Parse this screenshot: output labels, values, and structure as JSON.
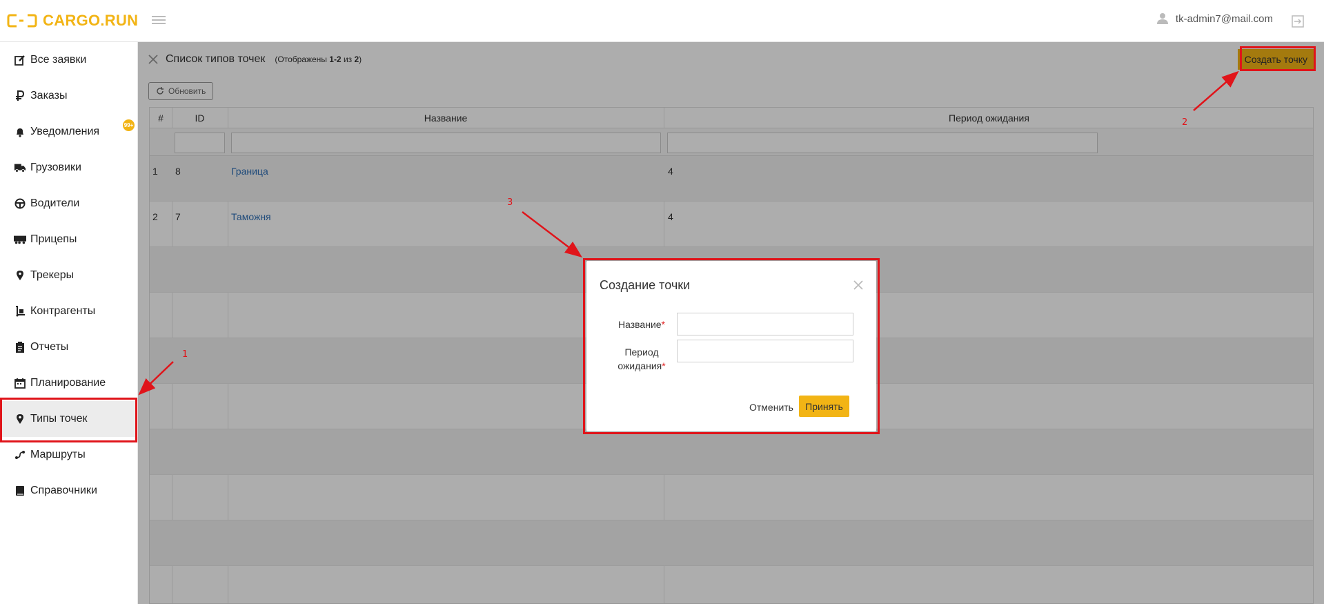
{
  "brand": {
    "name": "CARGO.RUN",
    "color": "#f2b415"
  },
  "header": {
    "user_email": "tk-admin7@mail.com",
    "menu_icon": "hamburger-icon",
    "user_icon": "user-icon",
    "logout_icon": "logout-icon"
  },
  "sidebar": {
    "items": [
      {
        "label": "Все заявки",
        "icon": "edit-icon"
      },
      {
        "label": "Заказы",
        "icon": "ruble-icon"
      },
      {
        "label": "Уведомления",
        "icon": "bell-icon",
        "badge": "99+"
      },
      {
        "label": "Грузовики",
        "icon": "truck-icon"
      },
      {
        "label": "Водители",
        "icon": "steering-wheel-icon"
      },
      {
        "label": "Прицепы",
        "icon": "trailer-icon"
      },
      {
        "label": "Трекеры",
        "icon": "map-pin-icon"
      },
      {
        "label": "Контрагенты",
        "icon": "dolly-icon"
      },
      {
        "label": "Отчеты",
        "icon": "clipboard-icon"
      },
      {
        "label": "Планирование",
        "icon": "calendar-icon"
      },
      {
        "label": "Типы точек",
        "icon": "map-pin-icon",
        "active": true
      },
      {
        "label": "Маршруты",
        "icon": "route-icon"
      },
      {
        "label": "Справочники",
        "icon": "book-icon"
      }
    ]
  },
  "page": {
    "title": "Список типов точек",
    "subtitle_prefix": "(Отображены ",
    "range": "1-2",
    "subtitle_mid": " из ",
    "total": "2",
    "subtitle_suffix": ")",
    "create_button": "Создать точку",
    "refresh_button": "Обновить"
  },
  "table": {
    "columns": [
      "#",
      "ID",
      "Название",
      "Период ожидания"
    ],
    "rows": [
      {
        "num": "1",
        "id": "8",
        "name": "Граница",
        "wait": "4"
      },
      {
        "num": "2",
        "id": "7",
        "name": "Таможня",
        "wait": "4"
      }
    ]
  },
  "modal": {
    "title": "Создание точки",
    "name_label": "Название",
    "period_label_line1": "Период",
    "period_label_line2": "ожидания",
    "required_mark": "*",
    "name_value": "",
    "period_value": "",
    "cancel": "Отменить",
    "accept": "Принять"
  },
  "annotations": {
    "step1": "1",
    "step2": "2",
    "step3": "3",
    "color": "#e0141a"
  }
}
